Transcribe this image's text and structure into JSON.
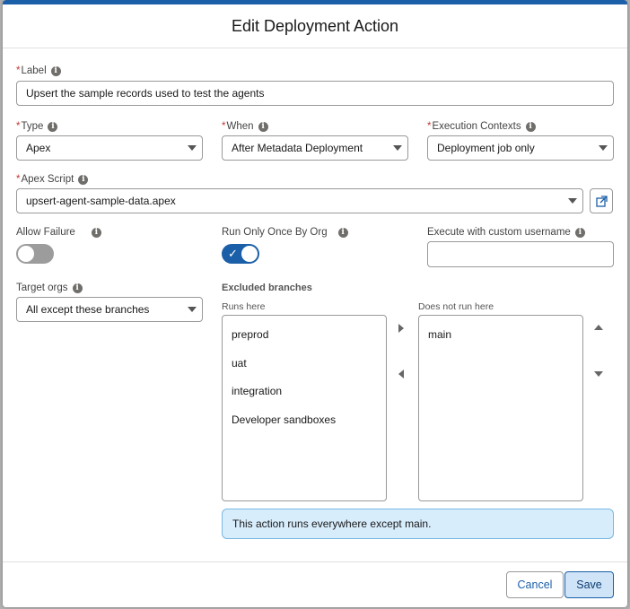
{
  "dialog": {
    "title": "Edit Deployment Action"
  },
  "form": {
    "label": {
      "label": "Label",
      "value": "Upsert the sample records used to test the agents"
    },
    "type": {
      "label": "Type",
      "value": "Apex"
    },
    "when": {
      "label": "When",
      "value": "After Metadata Deployment"
    },
    "execution_contexts": {
      "label": "Execution Contexts",
      "value": "Deployment job only"
    },
    "apex_script": {
      "label": "Apex Script",
      "value": "upsert-agent-sample-data.apex"
    },
    "allow_failure": {
      "label": "Allow Failure",
      "enabled": false
    },
    "run_only_once": {
      "label": "Run Only Once By Org",
      "enabled": true
    },
    "custom_username": {
      "label": "Execute with custom username",
      "value": ""
    },
    "target_orgs": {
      "label": "Target orgs",
      "value": "All except these branches"
    }
  },
  "branches": {
    "heading": "Excluded branches",
    "runs_here": {
      "label": "Runs here",
      "items": [
        "preprod",
        "uat",
        "integration",
        "Developer sandboxes"
      ]
    },
    "does_not_run_here": {
      "label": "Does not run here",
      "items": [
        "main"
      ]
    },
    "summary": "This action runs everywhere except main."
  },
  "footer": {
    "cancel_label": "Cancel",
    "save_label": "Save"
  },
  "colors": {
    "brand": "#1b5fa8",
    "required": "#c23934",
    "info_background": "#d8edfc"
  },
  "icons": {
    "info": "info-icon",
    "dropdown": "chevron-down-icon",
    "external": "new-window-icon",
    "check": "check-icon"
  }
}
